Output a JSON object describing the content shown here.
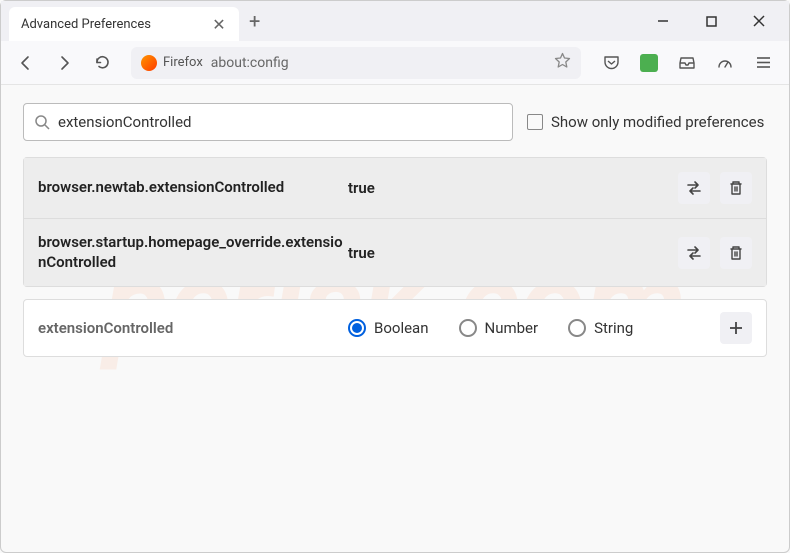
{
  "tab": {
    "title": "Advanced Preferences"
  },
  "address": {
    "label": "Firefox",
    "url": "about:config"
  },
  "search": {
    "value": "extensionControlled"
  },
  "checkbox": {
    "label": "Show only modified preferences"
  },
  "prefs": [
    {
      "name": "browser.newtab.extensionControlled",
      "value": "true"
    },
    {
      "name": "browser.startup.homepage_override.extensionControlled",
      "value": "true"
    }
  ],
  "newPref": {
    "name": "extensionControlled",
    "types": [
      "Boolean",
      "Number",
      "String"
    ],
    "selected": "Boolean"
  },
  "watermark": "pcrisk.com"
}
